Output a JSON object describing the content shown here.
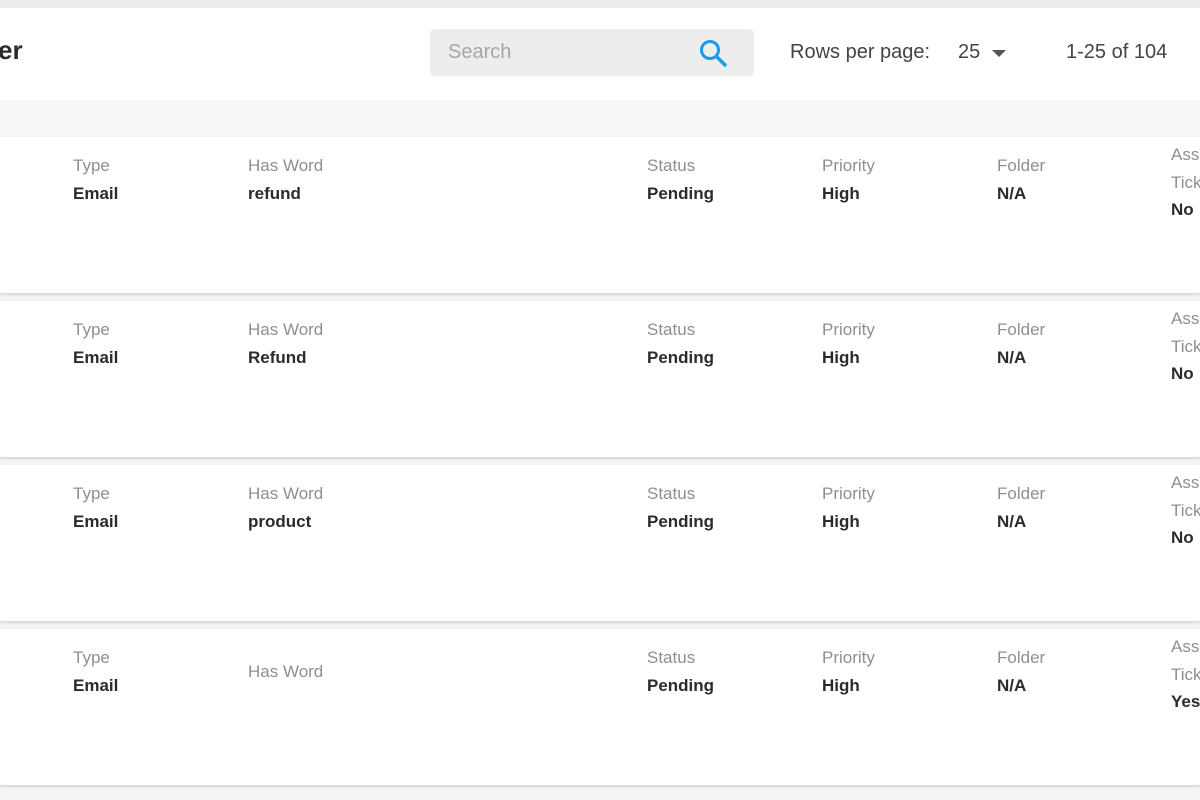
{
  "header": {
    "title": "er",
    "search_placeholder": "Search",
    "rows_per_page_label": "Rows per page:",
    "rows_per_page_value": "25",
    "page_range": "1-25 of 104"
  },
  "icons": {
    "search": "search-icon",
    "rows_dropdown": "caret-down-icon"
  },
  "colors": {
    "search_icon": "#1a9be6",
    "background": "#f4f4f4",
    "card": "#ffffff"
  },
  "rows": [
    {
      "type_label": "Type",
      "type_value": "Email",
      "word_label": "Has Word",
      "word_value": "refund",
      "status_label": "Status",
      "status_value": "Pending",
      "priority_label": "Priority",
      "priority_value": "High",
      "folder_label": "Folder",
      "folder_value": "N/A",
      "assign_label_1": "Ass",
      "assign_label_2": "Tick",
      "assign_value": "No"
    },
    {
      "type_label": "Type",
      "type_value": "Email",
      "word_label": "Has Word",
      "word_value": "Refund",
      "status_label": "Status",
      "status_value": "Pending",
      "priority_label": "Priority",
      "priority_value": "High",
      "folder_label": "Folder",
      "folder_value": "N/A",
      "assign_label_1": "Ass",
      "assign_label_2": "Tick",
      "assign_value": "No"
    },
    {
      "type_label": "Type",
      "type_value": "Email",
      "word_label": "Has Word",
      "word_value": "product",
      "status_label": "Status",
      "status_value": "Pending",
      "priority_label": "Priority",
      "priority_value": "High",
      "folder_label": "Folder",
      "folder_value": "N/A",
      "assign_label_1": "Ass",
      "assign_label_2": "Tick",
      "assign_value": "No"
    },
    {
      "type_label": "Type",
      "type_value": "Email",
      "word_label": "Has Word",
      "word_value": "",
      "status_label": "Status",
      "status_value": "Pending",
      "priority_label": "Priority",
      "priority_value": "High",
      "folder_label": "Folder",
      "folder_value": "N/A",
      "assign_label_1": "Ass",
      "assign_label_2": "Tick",
      "assign_value": "Yes"
    }
  ]
}
